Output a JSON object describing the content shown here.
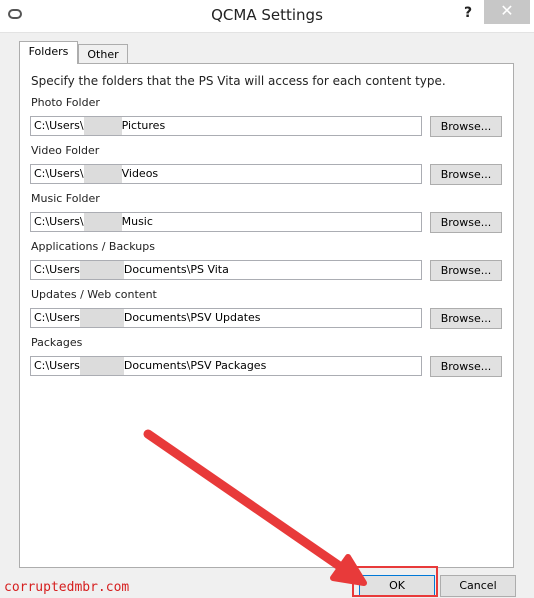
{
  "window": {
    "title": "QCMA Settings",
    "help_label": "?",
    "close_label": "✕"
  },
  "tabs": [
    {
      "label": "Folders",
      "active": true
    },
    {
      "label": "Other",
      "active": false
    }
  ],
  "instruction": "Specify the folders that the PS Vita will access for each content type.",
  "folders": [
    {
      "label": "Photo Folder",
      "path_prefix": "C:\\Users\\",
      "path_suffix": "Pictures"
    },
    {
      "label": "Video Folder",
      "path_prefix": "C:\\Users\\",
      "path_suffix": "Videos"
    },
    {
      "label": "Music Folder",
      "path_prefix": "C:\\Users\\",
      "path_suffix": "Music"
    },
    {
      "label": "Applications / Backups",
      "path_prefix": "C:\\Users",
      "path_suffix": "Documents\\PS Vita"
    },
    {
      "label": "Updates / Web content",
      "path_prefix": "C:\\Users",
      "path_suffix": "Documents\\PSV Updates"
    },
    {
      "label": "Packages",
      "path_prefix": "C:\\Users",
      "path_suffix": "Documents\\PSV Packages"
    }
  ],
  "browse_label": "Browse...",
  "buttons": {
    "ok": "OK",
    "cancel": "Cancel"
  },
  "watermark": "corruptedmbr.com",
  "colors": {
    "annotation_red": "#e83a3a",
    "close_button": "#c7c7c7",
    "focus_blue": "#0078d7"
  }
}
